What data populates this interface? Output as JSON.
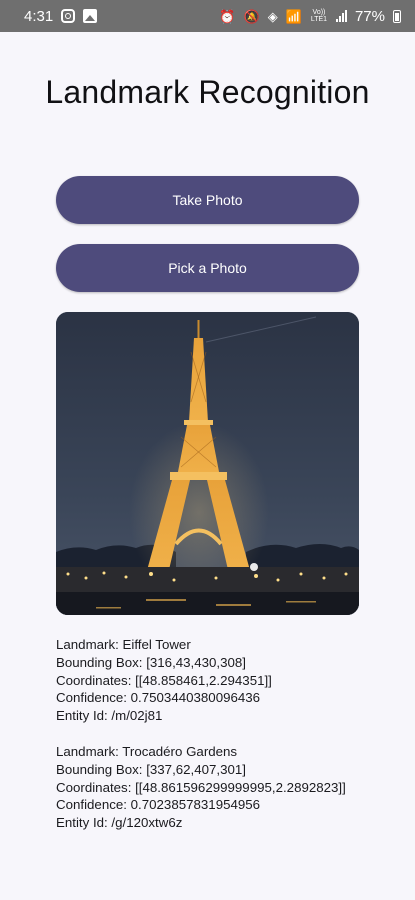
{
  "status_bar": {
    "time": "4:31",
    "battery": "77%",
    "network_label": "Vo)) LTE1"
  },
  "app": {
    "title": "Landmark Recognition"
  },
  "buttons": {
    "take_photo": "Take Photo",
    "pick_photo": "Pick a Photo"
  },
  "results": [
    {
      "landmark": "Landmark: Eiffel Tower",
      "bounding_box": "Bounding Box: [316,43,430,308]",
      "coordinates": "Coordinates: [[48.858461,2.294351]]",
      "confidence": "Confidence: 0.7503440380096436",
      "entity_id": "Entity Id: /m/02j81"
    },
    {
      "landmark": "Landmark: Trocadéro Gardens",
      "bounding_box": "Bounding Box: [337,62,407,301]",
      "coordinates": "Coordinates: [[48.861596299999995,2.2892823]]",
      "confidence": "Confidence: 0.7023857831954956",
      "entity_id": "Entity Id: /g/120xtw6z"
    }
  ],
  "colors": {
    "button": "#4e4b7c",
    "status_bar": "#6f6f6f",
    "background": "#f7f6fb"
  }
}
